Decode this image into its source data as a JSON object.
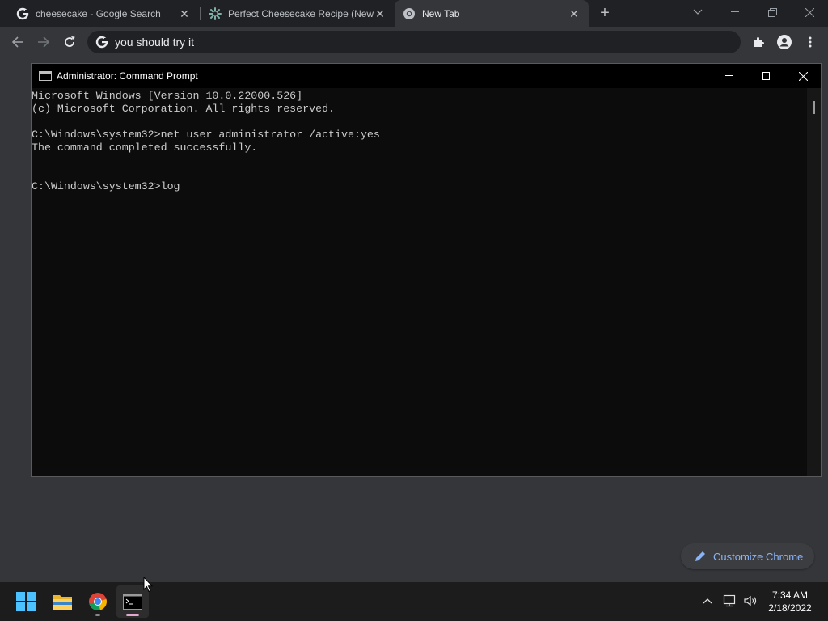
{
  "browser": {
    "tabs": [
      {
        "title": "cheesecake - Google Search",
        "favicon": "google-g-icon",
        "active": false
      },
      {
        "title": "Perfect Cheesecake Recipe (New",
        "favicon": "recipe-site-icon",
        "active": false
      },
      {
        "title": "New Tab",
        "favicon": "chrome-icon",
        "active": true
      }
    ],
    "omnibox": {
      "value": "you should try it"
    },
    "customize_label": "Customize Chrome",
    "accent_color": "#8ab4f8"
  },
  "cmd": {
    "title": "Administrator: Command Prompt",
    "lines": [
      "Microsoft Windows [Version 10.0.22000.526]",
      "(c) Microsoft Corporation. All rights reserved.",
      "",
      "C:\\Windows\\system32>net user administrator /active:yes",
      "The command completed successfully.",
      "",
      "",
      "C:\\Windows\\system32>log"
    ]
  },
  "taskbar": {
    "apps": [
      "start-icon",
      "file-explorer-icon",
      "chrome-icon",
      "command-prompt-icon"
    ],
    "clock": {
      "time": "7:34 AM",
      "date": "2/18/2022"
    }
  }
}
